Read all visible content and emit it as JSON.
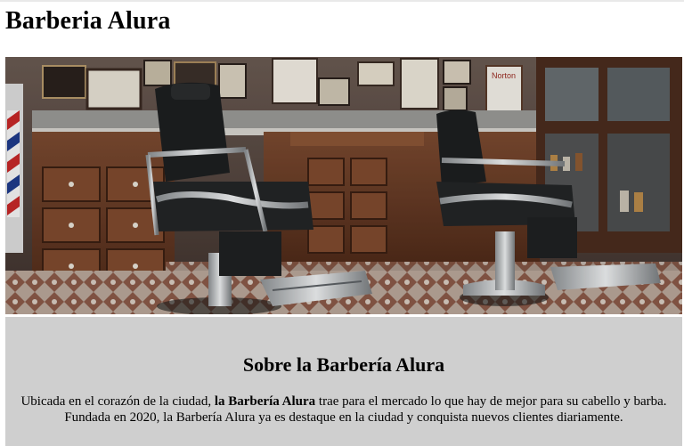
{
  "header": {
    "title": "Barberia Alura"
  },
  "hero": {
    "poster_text": "Norton"
  },
  "about": {
    "heading": "Sobre la Barbería Alura",
    "text_before": "Ubicada en el corazón de la ciudad, ",
    "text_bold": "la Barbería Alura",
    "text_after": " trae para el mercado lo que hay de mejor para su cabello y barba. Fundada en 2020, la Barbería Alura ya es destaque en la ciudad y conquista nuevos clientes diariamente."
  },
  "colors": {
    "about_background": "#cfcfcf",
    "wood": "#6b3c26",
    "leather": "#1d1f20",
    "chrome": "#c9ccce"
  }
}
